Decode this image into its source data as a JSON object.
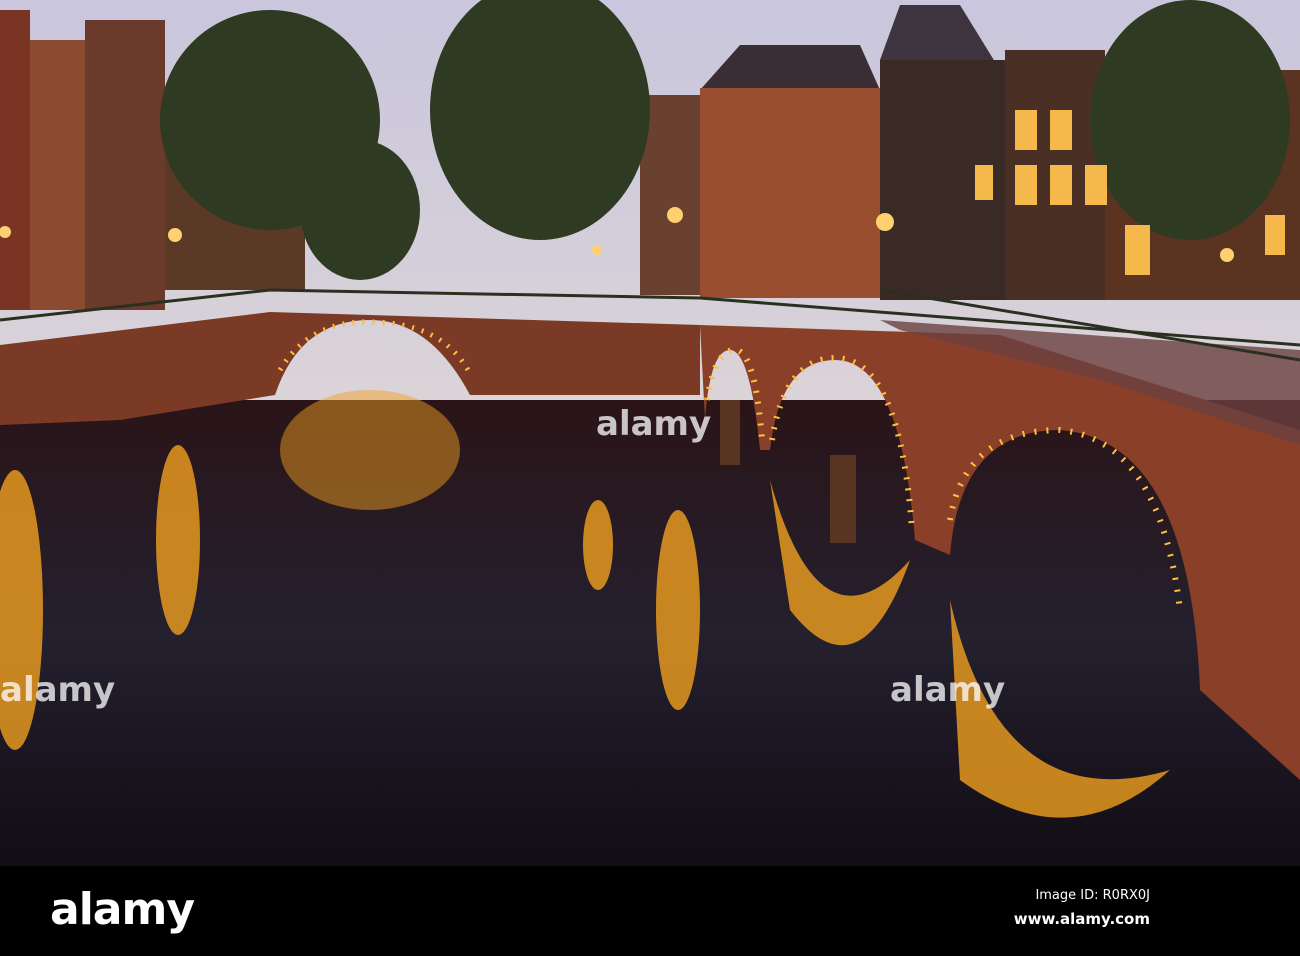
{
  "footer": {
    "logo": "alamy",
    "image_id": "Image ID: R0RX0J",
    "website": "www.alamy.com"
  },
  "watermark": "alamy",
  "colors": {
    "sky": "#d9d6e6",
    "water": "#1a0f18",
    "lights": "#ffb020",
    "brick": "#7a3a22"
  }
}
